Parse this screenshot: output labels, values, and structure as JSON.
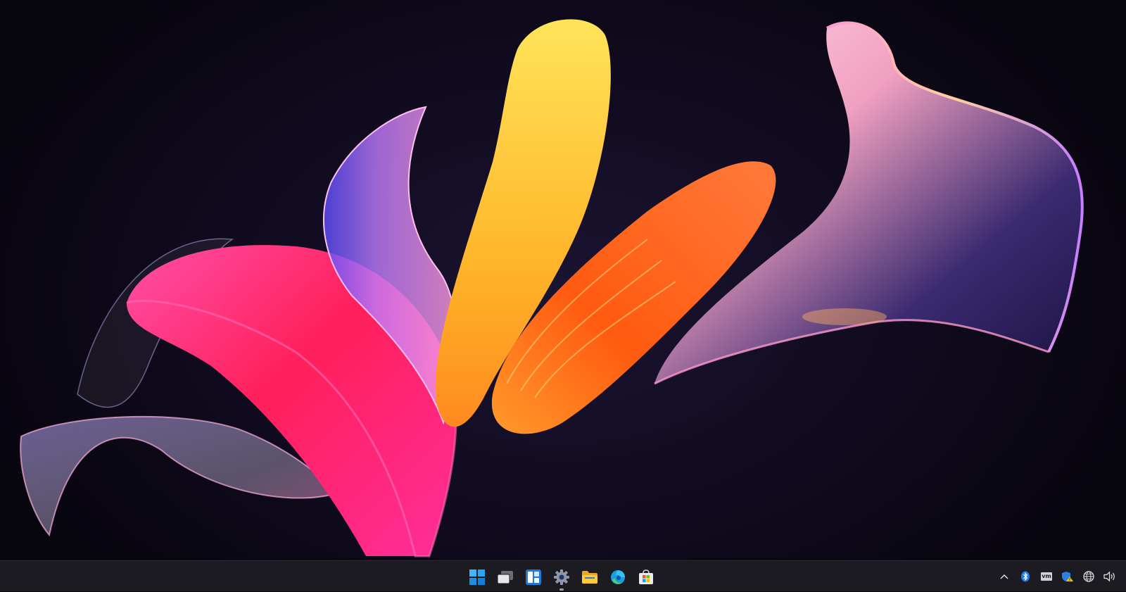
{
  "desktop": {
    "wallpaper": "abstract-3d-ribbons",
    "colors": {
      "background": "#0a0714",
      "pink": "#ff2d7a",
      "yellow": "#ffc83a",
      "orange": "#ff6a1a",
      "glass": "#c9b6ff"
    }
  },
  "taskbar": {
    "background": "#1c1b22",
    "apps": [
      {
        "name": "start-button",
        "icon": "windows-logo-icon"
      },
      {
        "name": "task-view-button",
        "icon": "task-view-icon"
      },
      {
        "name": "widgets-button",
        "icon": "widgets-icon"
      },
      {
        "name": "settings-app-button",
        "icon": "gear-icon",
        "running": true
      },
      {
        "name": "file-explorer-button",
        "icon": "folder-icon"
      },
      {
        "name": "edge-browser-button",
        "icon": "edge-icon"
      },
      {
        "name": "microsoft-store-button",
        "icon": "store-bag-icon"
      }
    ],
    "tray": {
      "vm_label": "vm",
      "icons": [
        "chevron-up-icon",
        "bluetooth-icon",
        "vm-icon",
        "security-shield-icon",
        "network-globe-icon",
        "speaker-icon"
      ]
    }
  }
}
